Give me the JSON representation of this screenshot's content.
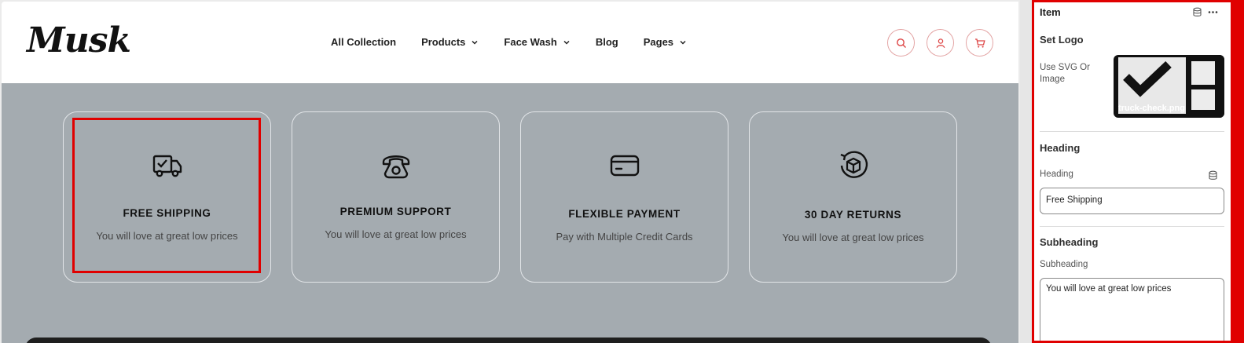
{
  "site": {
    "logo": "Musk",
    "nav": [
      {
        "label": "All Collection",
        "dropdown": false
      },
      {
        "label": "Products",
        "dropdown": true
      },
      {
        "label": "Face Wash",
        "dropdown": true
      },
      {
        "label": "Blog",
        "dropdown": false
      },
      {
        "label": "Pages",
        "dropdown": true
      }
    ],
    "header_icons": [
      "search-icon",
      "user-icon",
      "cart-icon"
    ],
    "accent_color": "#e3a4a4",
    "background_color": "#a4abb0"
  },
  "features": [
    {
      "icon": "truck-check-icon",
      "title": "FREE SHIPPING",
      "desc": "You will love at great low prices"
    },
    {
      "icon": "phone-icon",
      "title": "PREMIUM SUPPORT",
      "desc": "You will love at great low prices"
    },
    {
      "icon": "credit-card-icon",
      "title": "FLEXIBLE PAYMENT",
      "desc": "Pay with Multiple Credit Cards"
    },
    {
      "icon": "return-box-icon",
      "title": "30 DAY RETURNS",
      "desc": "You will love at great low prices"
    }
  ],
  "panel": {
    "title": "Item",
    "set_logo": "Set Logo",
    "use_svg_label": "Use SVG Or Image",
    "image_name": "truck-check.png",
    "heading_section": "Heading",
    "heading_label": "Heading",
    "heading_value": "Free Shipping",
    "subheading_section": "Subheading",
    "subheading_label": "Subheading",
    "subheading_value": "You will love at great low prices",
    "highlight_color": "#e00000"
  }
}
